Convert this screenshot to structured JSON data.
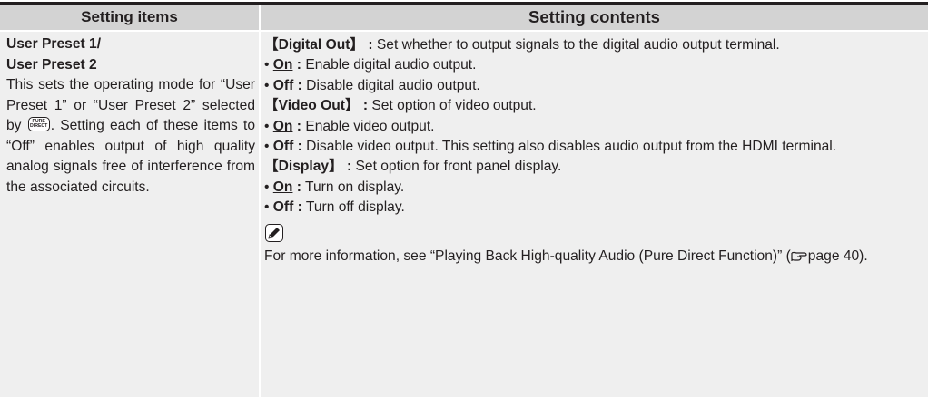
{
  "header": {
    "left": "Setting items",
    "right": "Setting contents"
  },
  "left": {
    "title_line1": "User Preset 1/",
    "title_line2": "User Preset 2",
    "desc_before_icon": "This sets the operating mode for “User Preset 1” or “User Preset 2” selected by",
    "desc_after_icon": ".",
    "desc2": "Setting each of these items to “Off” enables output of high quality analog signals free of interference from the associated circuits.",
    "icon_label_top": "PURE",
    "icon_label_bottom": "DIRECT"
  },
  "right": {
    "digital_out": {
      "name": "【Digital Out】 :",
      "desc": " Set whether to output signals to the digital audio output terminal.",
      "on_label": "On",
      "on_colon": " :",
      "on_desc": " Enable digital audio output.",
      "off_label": "Off :",
      "off_desc": " Disable digital audio output."
    },
    "video_out": {
      "name": "【Video Out】 :",
      "desc": " Set option of video output.",
      "on_label": "On",
      "on_colon": " :",
      "on_desc": " Enable video output.",
      "off_label": "Off :",
      "off_desc": " Disable video output. This setting also disables audio output from the HDMI terminal."
    },
    "display": {
      "name": "【Display】 :",
      "desc": " Set option for front panel display.",
      "on_label": "On",
      "on_colon": " :",
      "on_desc": " Turn on display.",
      "off_label": "Off :",
      "off_desc": " Turn off display."
    },
    "note_before": "For more information, see “Playing Back High-quality Audio (Pure Direct Function)” (",
    "note_page": "page 40",
    "note_after": ")."
  }
}
